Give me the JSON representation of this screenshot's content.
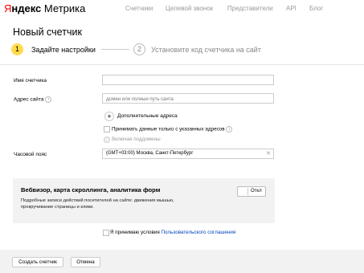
{
  "header": {
    "logo": {
      "first": "Я",
      "rest": "ндекс",
      "product": "Метрика"
    },
    "nav": [
      "Счетчики",
      "Целевой звонок",
      "Представители",
      "API",
      "Блог"
    ]
  },
  "page": {
    "title": "Новый счетчик",
    "steps": [
      {
        "number": "1",
        "label": "Задайте настройки",
        "active": true
      },
      {
        "number": "2",
        "label": "Установите код счетчика на сайт",
        "active": false
      }
    ]
  },
  "form": {
    "name": {
      "label": "Имя счетчика",
      "value": ""
    },
    "site": {
      "label": "Адрес сайта",
      "info_icon": "info-icon",
      "placeholder": "Домен или полный путь сайта"
    },
    "add_addresses": {
      "icon": "plus-icon",
      "label": "Дополнительные адреса"
    },
    "only_specified": {
      "label": "Принимать данные только с указанных адресов",
      "checked": false
    },
    "subdomains": {
      "label": "Включая поддомены",
      "checked": false,
      "disabled": true
    },
    "timezone": {
      "label": "Часовой пояс",
      "value": "(GMT+03:00) Москва, Санкт-Петербург",
      "clear_icon": "close-icon"
    }
  },
  "webvisor": {
    "title": "Вебвизор, карта скроллинга, аналитика форм",
    "description": "Подробные записи действий посетителей на сайте: движения мышью, прокручивание страницы и клики.",
    "toggle_label": "Откл",
    "enabled": false
  },
  "terms": {
    "prefix": "Я принимаю условия ",
    "link": "Пользовательского соглашения",
    "checked": false
  },
  "footer": {
    "create_label": "Создать счетчик",
    "cancel_label": "Отмена"
  },
  "colors": {
    "accent_yellow": "#ffdb4d",
    "logo_red": "#ff0000",
    "link_blue": "#0044bb",
    "panel_gray": "#f2f2f2"
  }
}
